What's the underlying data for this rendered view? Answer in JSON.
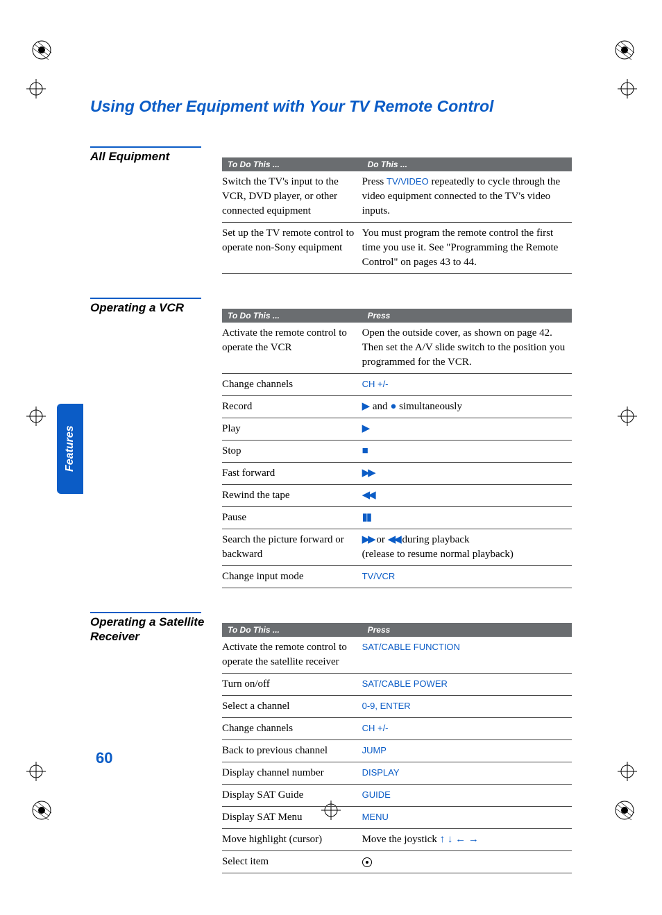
{
  "title": "Using Other Equipment with Your TV Remote Control",
  "sideTab": "Features",
  "pageNumber": "60",
  "sections": {
    "allEquipment": {
      "label": "All Equipment",
      "headers": [
        "To Do This ...",
        "Do This ..."
      ],
      "rows": [
        {
          "todo": "Switch the TV's input to the VCR, DVD player, or other connected equipment",
          "action_pre": "Press ",
          "action_blue": "TV/VIDEO",
          "action_post": " repeatedly to cycle through the video equipment connected to the TV's video inputs."
        },
        {
          "todo": "Set up the TV remote control to operate non-Sony equipment",
          "action_full": "You must program the remote control the first time you use it. See \"Programming the Remote Control\" on pages 43 to 44."
        }
      ]
    },
    "vcr": {
      "label": "Operating a VCR",
      "headers": [
        "To Do This ...",
        "Press"
      ],
      "rows": {
        "activate": {
          "todo": "Activate the remote control to operate the VCR",
          "press": "Open the outside cover, as shown on page 42. Then set the A/V slide switch to the position you programmed for the VCR."
        },
        "channels": {
          "todo": "Change channels",
          "press": "CH +/-"
        },
        "record": {
          "todo": "Record",
          "press_suffix": " and ",
          "press_suffix2": " simultaneously"
        },
        "play": {
          "todo": "Play"
        },
        "stop": {
          "todo": "Stop"
        },
        "ff": {
          "todo": "Fast forward"
        },
        "rewind": {
          "todo": "Rewind the tape"
        },
        "pause": {
          "todo": "Pause"
        },
        "search": {
          "todo": "Search the picture forward or backward",
          "mid": " or ",
          "end": " during playback",
          "line2": "(release to resume normal playback)"
        },
        "input": {
          "todo": "Change input mode",
          "press": "TV/VCR"
        }
      }
    },
    "sat": {
      "label": "Operating a Satellite Receiver",
      "headers": [
        "To Do This ...",
        "Press"
      ],
      "rows": {
        "activate": {
          "todo": "Activate the remote control to operate the satellite receiver",
          "press": "SAT/CABLE FUNCTION"
        },
        "onoff": {
          "todo": "Turn on/off",
          "press": "SAT/CABLE POWER"
        },
        "select": {
          "todo": "Select a channel",
          "press": "0-9, ENTER"
        },
        "change": {
          "todo": "Change channels",
          "press": "CH +/-"
        },
        "back": {
          "todo": "Back to previous channel",
          "press": "JUMP"
        },
        "chnum": {
          "todo": "Display channel number",
          "press": "DISPLAY"
        },
        "guide": {
          "todo": "Display SAT Guide",
          "press": "GUIDE"
        },
        "menu": {
          "todo": "Display SAT Menu",
          "press": "MENU"
        },
        "move": {
          "todo": "Move highlight (cursor)",
          "press_pre": "Move the joystick "
        },
        "selectitem": {
          "todo": "Select item"
        }
      }
    }
  }
}
